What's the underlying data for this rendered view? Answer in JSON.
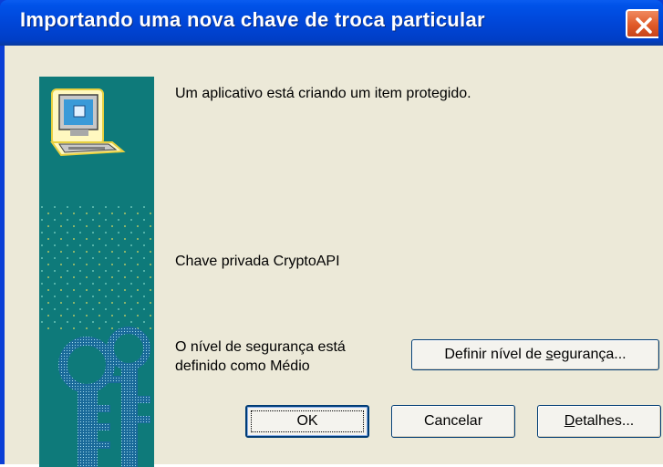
{
  "window": {
    "title": "Importando uma nova chave de troca particular"
  },
  "content": {
    "message": "Um aplicativo está criando um item protegido.",
    "key_name": "Chave privada CryptoAPI",
    "security_level_line1": "O nível de segurança está",
    "security_level_line2": "definido como Médio"
  },
  "buttons": {
    "set_security_level_before": "Definir nível de ",
    "set_security_level_mnemonic": "s",
    "set_security_level_after": "egurança...",
    "ok": "OK",
    "cancel": "Cancelar",
    "details_mnemonic": "D",
    "details_after": "etalhes..."
  },
  "icons": {
    "close": "close-icon",
    "computer": "computer-icon",
    "keys": "keys-icon"
  },
  "colors": {
    "titlebar": "#0046d8",
    "dialog_background": "#ece9d8",
    "side_panel": "#0e7a7a",
    "close_button": "#e05a28"
  }
}
